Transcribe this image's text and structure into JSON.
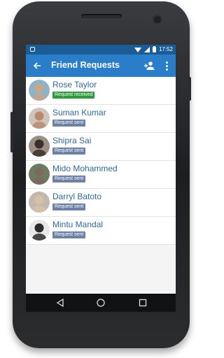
{
  "status_bar": {
    "time": "17:52"
  },
  "app_bar": {
    "title": "Friend Requests"
  },
  "colors": {
    "appbar": "#2a7dc8",
    "statusbar": "#1a5d96",
    "received": "#2f9b3d",
    "sent": "#6b81a8",
    "name": "#2d6a9e"
  },
  "icons": {
    "back": "arrow-back-icon",
    "add": "add-person-icon",
    "menu": "overflow-menu-icon"
  },
  "requests": [
    {
      "name": "Rose Taylor",
      "status": "Request received",
      "type": "received"
    },
    {
      "name": "Suman Kumar",
      "status": "Request sent",
      "type": "sent"
    },
    {
      "name": "Shipra Sai",
      "status": "Request sent",
      "type": "sent"
    },
    {
      "name": "Mido Mohammed",
      "status": "Request sent",
      "type": "sent"
    },
    {
      "name": "Darryl Batoto",
      "status": "Request sent",
      "type": "sent"
    },
    {
      "name": "Mintu Mandal",
      "status": "Request sent",
      "type": "sent"
    }
  ]
}
